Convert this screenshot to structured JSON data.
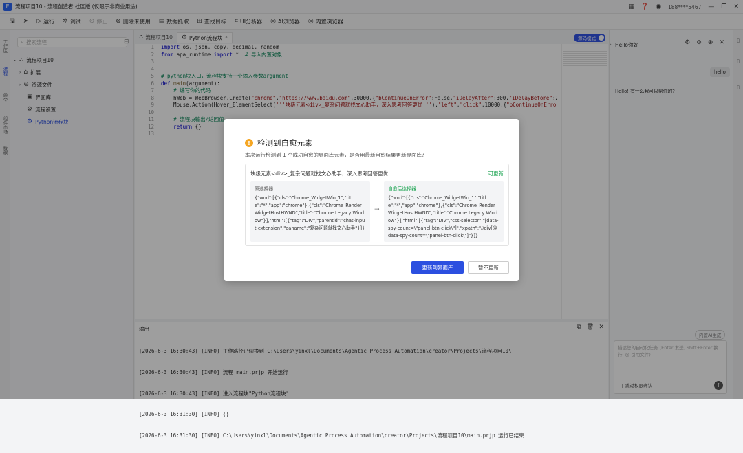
{
  "window": {
    "title": "流程项目10 - 流程创造者 社区版 (仅限于非商业用途)",
    "user": "188****5467",
    "logo_char": "E"
  },
  "toolbar": {
    "items": [
      {
        "label": "保存",
        "icon": "save-icon"
      },
      {
        "label": "运行",
        "icon": "play-icon"
      },
      {
        "label": "调试",
        "icon": "bug-icon"
      },
      {
        "label": "停止",
        "icon": "stop-icon"
      },
      {
        "label": "删除未使用",
        "icon": "delete-icon"
      },
      {
        "label": "数据抓取",
        "icon": "grid-icon"
      },
      {
        "label": "查找目标",
        "icon": "target-icon"
      },
      {
        "label": "UI分析器",
        "icon": "analyzer-icon"
      },
      {
        "label": "AI浏览器",
        "icon": "ai-browser-icon"
      },
      {
        "label": "内置浏览器",
        "icon": "browser-icon"
      }
    ]
  },
  "activity_bar": [
    "工作区",
    "流程",
    "命令",
    "组件市场",
    "数据"
  ],
  "sidebar": {
    "search_placeholder": "搜索流程",
    "items": [
      {
        "label": "流程项目10"
      },
      {
        "label": "扩展"
      },
      {
        "label": "资源文件"
      },
      {
        "label": "界面库"
      },
      {
        "label": "流程设置"
      },
      {
        "label": "Python流程块"
      }
    ]
  },
  "editor": {
    "tabs": [
      {
        "label": "流程项目10"
      },
      {
        "label": "Python流程块"
      }
    ],
    "source_mode_label": "源码模式",
    "line_numbers": [
      "1",
      "2",
      "3",
      "4",
      "5",
      "6",
      "7",
      "8",
      "9",
      "10",
      "11",
      "12",
      "13"
    ]
  },
  "output": {
    "title": "输出",
    "lines": [
      "[2026-6-3 16:30:43] [INFO] 工作路径已切换到 C:\\Users\\yinxl\\Documents\\Agentic Process Automation\\creator\\Projects\\流程项目10\\",
      "[2026-6-3 16:30:43] [INFO] 流程 main.prjp 开始运行",
      "[2026-6-3 16:30:43] [INFO] 进入流程块\"Python流程块\"",
      "[2026-6-3 16:31:30] [INFO] {}",
      "[2026-6-3 16:31:30] [INFO] C:\\Users\\yinxl\\Documents\\Agentic Process Automation\\creator\\Projects\\流程项目10\\main.prjp 运行已结束"
    ]
  },
  "chat": {
    "title": "Hello你好",
    "user_msg": "hello",
    "reply": "Hello! 有什么我可以帮你的?",
    "tag": "内置AI生成",
    "input_placeholder": "描述您的自动化任务 (Enter 发送, Shift+Enter 换行, @ 引用文件)",
    "skip_label": "跳过权限确认"
  },
  "modal": {
    "title": "检测到自愈元素",
    "description": "本次运行检测到 1 个成功自愈的界面库元素，是否用最新自愈结果更新界面库?",
    "element_label": "块级元素<div>_复杂问题就找文心助手，深入思考回答更优",
    "status_tag": "可更新",
    "original_label": "原选择器",
    "original_text": "{\"wnd\":[{\"cls\":\"Chrome_WidgetWin_1\",\"title\":\"*\",\"app\":\"chrome\"},{\"cls\":\"Chrome_RenderWidgetHostHWND\",\"title\":\"Chrome Legacy Window\"}],\"html\":[{\"tag\":\"DIV\",\"parentid\":\"chat-input-extension\",\"aaname\":\"复杂问题就找文心助手\"}]}",
    "healed_label": "自愈后选择器",
    "healed_text": "{\"wnd\":[{\"cls\":\"Chrome_WidgetWin_1\",\"title\":\"*\",\"app\":\"chrome\"},{\"cls\":\"Chrome_RenderWidgetHostHWND\",\"title\":\"Chrome Legacy Window\"}],\"html\":[{\"tag\":\"DIV\",\"css-selector\":\"[data-spy-count=\\\"panel-btn-click\\\"]\",\"xpath\":\"//div[@data-spy-count=\\\"panel-btn-click\\\"]\"}]}",
    "arrow": "→",
    "confirm_label": "更新到界面库",
    "cancel_label": "暂不更新"
  }
}
